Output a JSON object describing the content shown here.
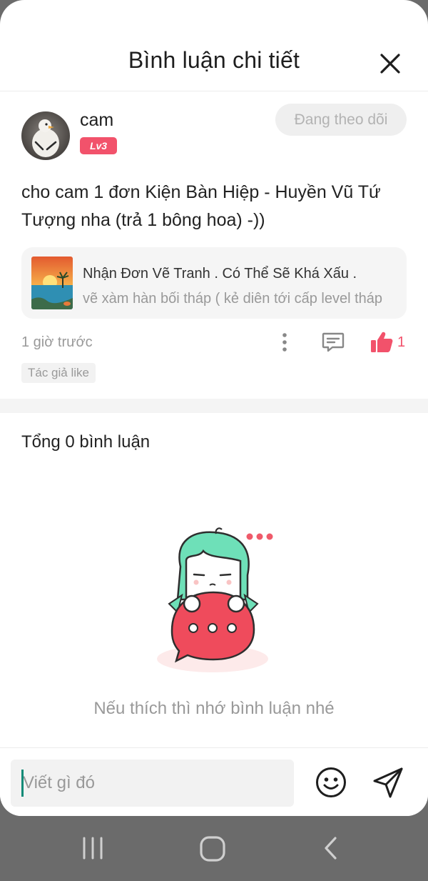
{
  "header": {
    "title": "Bình luận chi tiết",
    "close_icon": "close-icon"
  },
  "post": {
    "username": "cam",
    "level": "Lv3",
    "follow_label": "Đang theo dõi",
    "text": "cho cam 1 đơn Kiện Bàn Hiệp - Huyền Vũ Tứ Tượng nha (trả 1 bông hoa) -))",
    "link_card": {
      "title": "Nhận Đơn Vẽ Tranh . Có Thể Sẽ Khá Xấu .",
      "subtitle": "vẽ xàm hàn bối tháp ( kẻ diên tới cấp level tháp"
    },
    "time": "1 giờ trước",
    "like_count": "1",
    "author_like_badge": "Tác giả like"
  },
  "comments": {
    "total_label": "Tổng 0 bình luận",
    "empty_text": "Nếu thích thì nhớ bình luận nhé"
  },
  "composer": {
    "placeholder": "Viết gì đó"
  },
  "colors": {
    "accent": "#f2526b",
    "muted_text": "#999999",
    "illustration_hair": "#6ee0b8",
    "illustration_bubble": "#ef4b5c"
  },
  "icons": [
    "close-icon",
    "more-vertical-icon",
    "comment-icon",
    "thumbs-up-icon",
    "emoji-icon",
    "send-icon",
    "recent-apps-icon",
    "home-icon",
    "back-icon"
  ]
}
